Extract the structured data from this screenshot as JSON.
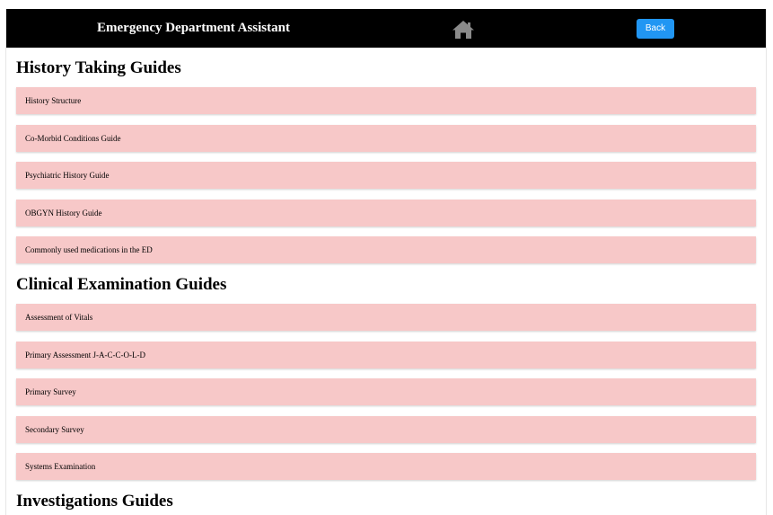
{
  "header": {
    "title": "Emergency Department Assistant",
    "home_icon": "home-icon",
    "back_label": "Back",
    "background": "#000000",
    "back_color": "#2196f3"
  },
  "sections": [
    {
      "title": "History Taking Guides",
      "items": [
        {
          "label": "History Structure"
        },
        {
          "label": "Co-Morbid Conditions Guide"
        },
        {
          "label": "Psychiatric History Guide"
        },
        {
          "label": "OBGYN History Guide"
        },
        {
          "label": "Commonly used medications in the ED"
        }
      ]
    },
    {
      "title": "Clinical Examination Guides",
      "items": [
        {
          "label": "Assessment of Vitals"
        },
        {
          "label": "Primary Assessment J-A-C-C-O-L-D"
        },
        {
          "label": "Primary Survey"
        },
        {
          "label": "Secondary Survey"
        },
        {
          "label": "Systems Examination"
        }
      ]
    },
    {
      "title": "Investigations Guides",
      "items": []
    }
  ],
  "item_color": "#f7c8c8"
}
